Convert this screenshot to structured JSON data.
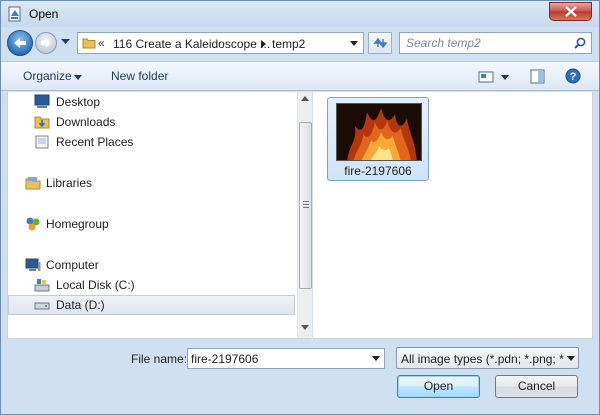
{
  "window": {
    "title": "Open"
  },
  "address": {
    "overflow_chevron": "«",
    "segments": [
      "116 Create a Kaleidoscope ...",
      "temp2"
    ]
  },
  "search": {
    "placeholder": "Search temp2"
  },
  "toolbar": {
    "organize": "Organize",
    "new_folder": "New folder"
  },
  "nav": {
    "items": [
      {
        "label": "Desktop",
        "icon": "desktop-icon"
      },
      {
        "label": "Downloads",
        "icon": "downloads-folder-icon"
      },
      {
        "label": "Recent Places",
        "icon": "recent-places-icon"
      },
      {
        "label": "Libraries",
        "icon": "libraries-icon"
      },
      {
        "label": "Homegroup",
        "icon": "homegroup-icon"
      },
      {
        "label": "Computer",
        "icon": "computer-icon"
      },
      {
        "label": "Local Disk (C:)",
        "icon": "local-disk-icon"
      },
      {
        "label": "Data (D:)",
        "icon": "drive-icon",
        "selected": true
      }
    ]
  },
  "files": [
    {
      "name": "fire-2197606",
      "icon": "fire-image-thumbnail",
      "selected": true
    }
  ],
  "bottom": {
    "file_name_label": "File name:",
    "file_name_value": "fire-2197606",
    "file_type": "All image types (*.pdn; *.png; *",
    "open_label": "Open",
    "cancel_label": "Cancel"
  },
  "colors": {
    "accent": "#3c7fb1",
    "close": "#c75050",
    "selection": "#cfe4f7"
  }
}
